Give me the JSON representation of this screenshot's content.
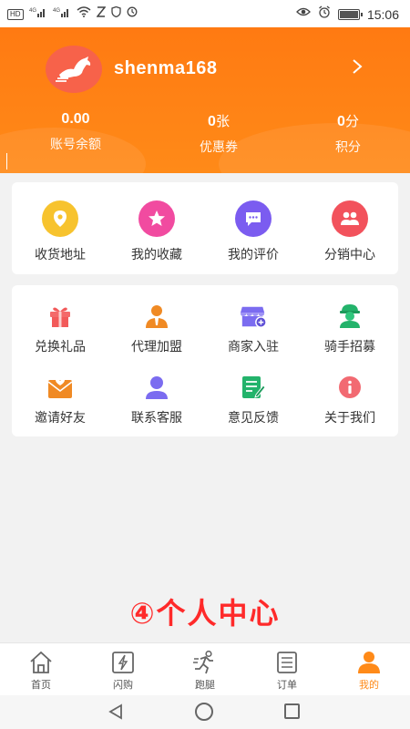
{
  "status_bar": {
    "left_icons": [
      "HD",
      "4G",
      "4G",
      "wifi-icon",
      "nfc-icon",
      "shield-icon",
      "sync-icon"
    ],
    "right_icons": [
      "eye-icon",
      "alarm-icon",
      "battery-icon"
    ],
    "battery_level": 0.9,
    "time": "15:06"
  },
  "profile": {
    "username": "shenma168",
    "avatar_icon": "horse-logo-icon",
    "arrow_icon": "chevron-right-icon",
    "stats": [
      {
        "value": "0.00",
        "unit": "",
        "label": "账号余额"
      },
      {
        "value": "0",
        "unit": "张",
        "label": "优惠券"
      },
      {
        "value": "0",
        "unit": "分",
        "label": "积分"
      }
    ]
  },
  "quick_menu": [
    {
      "label": "收货地址",
      "icon": "location-icon",
      "color": "#f7c32e"
    },
    {
      "label": "我的收藏",
      "icon": "star-icon",
      "color": "#f14ba0"
    },
    {
      "label": "我的评价",
      "icon": "comment-icon",
      "color": "#7b5cf0"
    },
    {
      "label": "分销中心",
      "icon": "users-icon",
      "color": "#f2525c"
    }
  ],
  "services": [
    {
      "label": "兑换礼品",
      "icon": "gift-icon",
      "color": "#f25a5a"
    },
    {
      "label": "代理加盟",
      "icon": "agent-icon",
      "color": "#f08a24"
    },
    {
      "label": "商家入驻",
      "icon": "store-icon",
      "color": "#7b6cf0"
    },
    {
      "label": "骑手招募",
      "icon": "rider-icon",
      "color": "#23b36b"
    },
    {
      "label": "邀请好友",
      "icon": "envelope-icon",
      "color": "#f08a24"
    },
    {
      "label": "联系客服",
      "icon": "customer-service-icon",
      "color": "#7b6cf0"
    },
    {
      "label": "意见反馈",
      "icon": "feedback-icon",
      "color": "#23b36b"
    },
    {
      "label": "关于我们",
      "icon": "info-icon",
      "color": "#f26a72"
    }
  ],
  "caption": "④个人中心",
  "tabs": [
    {
      "label": "首页",
      "icon": "home-icon",
      "active": false
    },
    {
      "label": "闪购",
      "icon": "flash-icon",
      "active": false
    },
    {
      "label": "跑腿",
      "icon": "runner-icon",
      "active": false
    },
    {
      "label": "订单",
      "icon": "order-list-icon",
      "active": false
    },
    {
      "label": "我的",
      "icon": "person-icon",
      "active": true
    }
  ],
  "colors": {
    "brand": "#ff8a18",
    "caption": "#ff2a2a",
    "background": "#f2f2f2"
  }
}
